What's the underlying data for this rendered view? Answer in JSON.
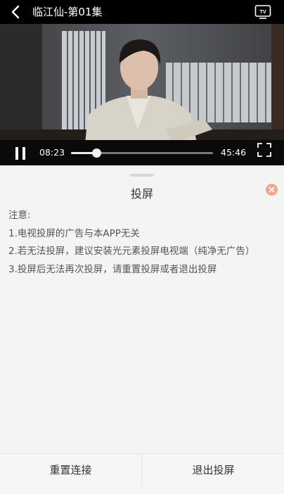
{
  "header": {
    "title": "临江仙-第01集",
    "back_icon": "chevron-left-icon",
    "cast_icon": "tv-icon"
  },
  "player": {
    "current_time": "08:23",
    "total_time": "45:46",
    "progress": 0.18,
    "play_state_icon": "pause-icon",
    "fullscreen_icon": "fullscreen-icon"
  },
  "cast_sheet": {
    "title": "投屏",
    "close_icon": "close-icon",
    "close_color": "#f4a78d",
    "notes": [
      "注意:",
      "1.电视投屏的广告与本APP无关",
      "2.若无法投屏，建议安装光元素投屏电视端（纯净无广告）",
      "3.投屏后无法再次投屏，请重置投屏或者退出投屏"
    ],
    "buttons": {
      "reset": "重置连接",
      "exit": "退出投屏"
    }
  }
}
